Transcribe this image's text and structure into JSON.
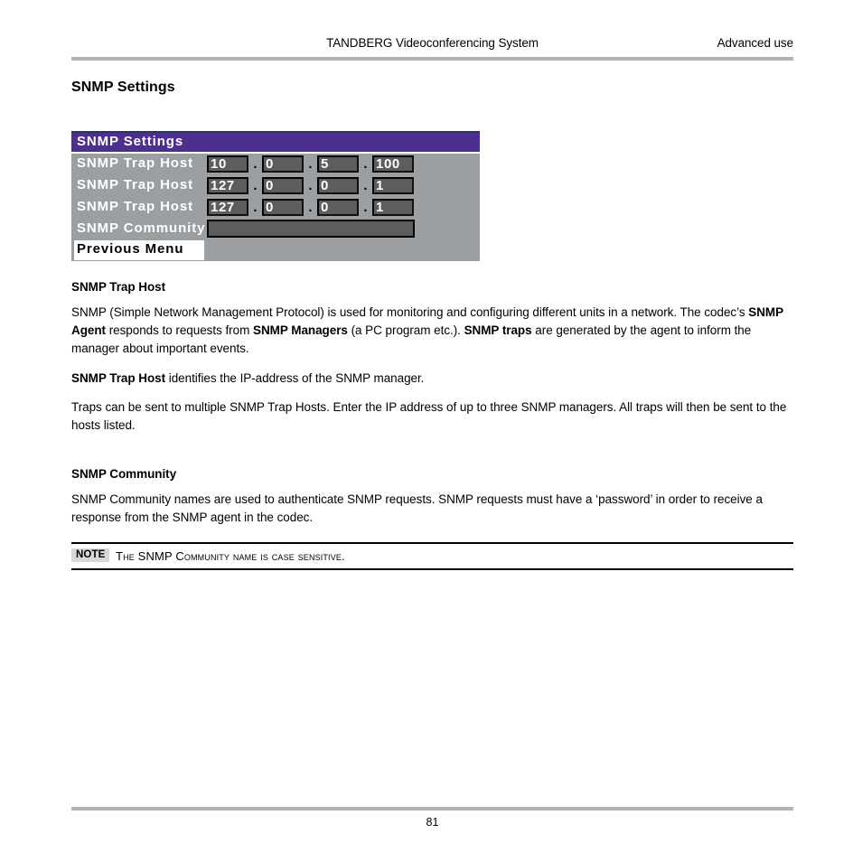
{
  "header": {
    "center_title": "TANDBERG Videoconferencing System",
    "right_label": "Advanced use"
  },
  "page_title": "SNMP Settings",
  "osd_menu": {
    "title": "SNMP Settings",
    "rows": [
      {
        "label": "SNMP Trap Host",
        "type": "ip",
        "octets": [
          "10",
          "0",
          "5",
          "100"
        ],
        "separator": "."
      },
      {
        "label": "SNMP Trap Host",
        "type": "ip",
        "octets": [
          "127",
          "0",
          "0",
          "1"
        ],
        "separator": "."
      },
      {
        "label": "SNMP Trap Host",
        "type": "ip",
        "octets": [
          "127",
          "0",
          "0",
          "1"
        ],
        "separator": "."
      },
      {
        "label": "SNMP Community",
        "type": "text",
        "value": ""
      },
      {
        "label": "Previous Menu",
        "type": "menu-item",
        "selected": true
      }
    ],
    "colors": {
      "titlebar": "#4c2f8e",
      "body": "#9b9fa1",
      "field": "#5d5d5d",
      "field_text": "#ffffff",
      "selection": "#ffffff"
    }
  },
  "sections": [
    {
      "heading": "SNMP Trap Host",
      "paragraphs": [
        {
          "runs": [
            {
              "text": "SNMP (Simple Network Management Protocol) is used for monitoring and configuring different units in a network. The codec’s ",
              "bold": false
            },
            {
              "text": "SNMP Agent",
              "bold": true
            },
            {
              "text": " responds to requests from ",
              "bold": false
            },
            {
              "text": "SNMP Managers",
              "bold": true
            },
            {
              "text": " (a PC program etc.). ",
              "bold": false
            },
            {
              "text": "SNMP traps",
              "bold": true
            },
            {
              "text": " are generated by the agent to inform the manager about important events.",
              "bold": false
            }
          ]
        },
        {
          "runs": [
            {
              "text": "SNMP Trap Host",
              "bold": true
            },
            {
              "text": " identifies the IP-address of the SNMP manager.",
              "bold": false
            }
          ]
        },
        {
          "runs": [
            {
              "text": "Traps can be sent to multiple SNMP Trap Hosts. Enter the IP address of up to three SNMP managers. All traps will then be sent to the hosts listed.",
              "bold": false
            }
          ]
        }
      ]
    },
    {
      "heading": "SNMP Community",
      "paragraphs": [
        {
          "runs": [
            {
              "text": "SNMP Community names are used to authenticate SNMP requests. SNMP requests must have a ‘password’ in order to receive a response from the SNMP agent in the codec.",
              "bold": false
            }
          ]
        }
      ]
    }
  ],
  "note": {
    "badge": "NOTE",
    "text": "The SNMP Community name is case sensitive."
  },
  "footer": {
    "page_number": "81"
  }
}
